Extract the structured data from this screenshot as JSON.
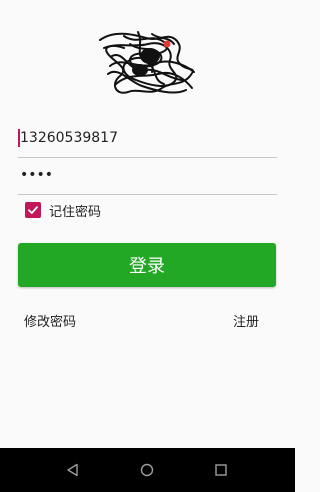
{
  "login_form": {
    "phone_value": "13260539817",
    "password_value": "••••",
    "remember_label": "记住密码",
    "remember_checked": true,
    "login_button_label": "登录"
  },
  "links": {
    "change_password": "修改密码",
    "register": "注册"
  },
  "icons": {
    "avatar": "avatar-image",
    "checkbox": "check-icon",
    "back": "back-icon",
    "home": "home-icon",
    "recent": "recent-apps-icon"
  },
  "colors": {
    "accent": "#c2185b",
    "primary_button": "#23a826",
    "nav_bar": "#000000"
  }
}
